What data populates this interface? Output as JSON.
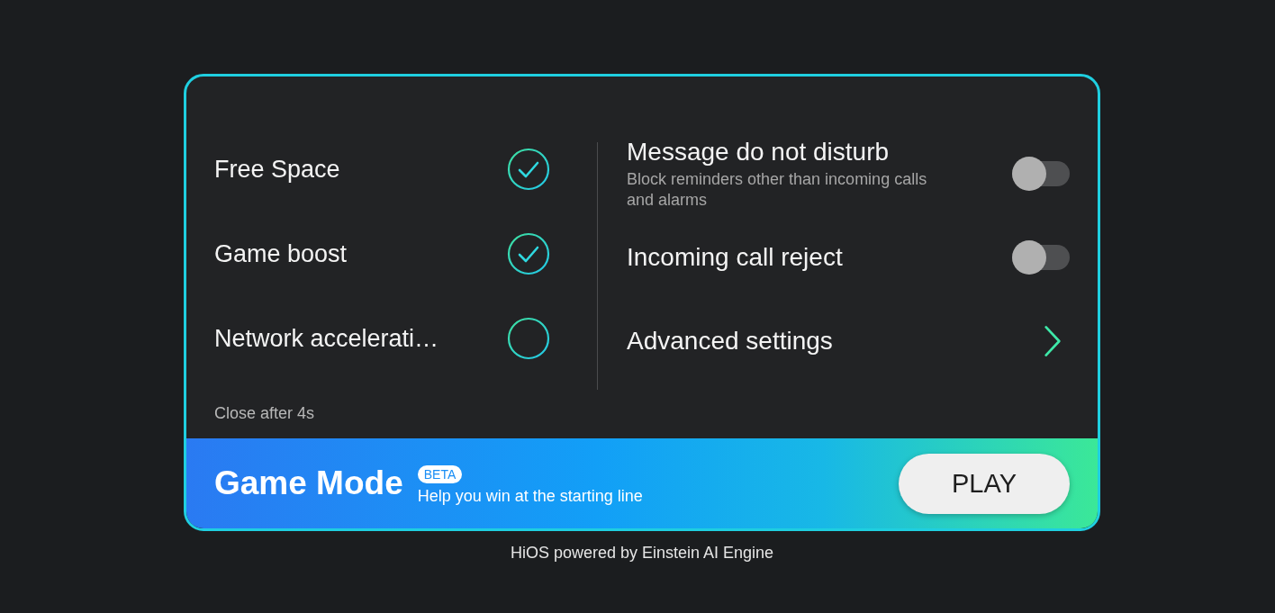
{
  "left_options": [
    {
      "label": "Free Space",
      "checked": true
    },
    {
      "label": "Game boost",
      "checked": true
    },
    {
      "label": "Network accelerati…",
      "checked": false
    }
  ],
  "close_notice": "Close after 4s",
  "right_options": [
    {
      "kind": "toggle",
      "title": "Message do not disturb",
      "subtitle": "Block reminders other than incoming calls and alarms",
      "on": false
    },
    {
      "kind": "toggle",
      "title": "Incoming call reject",
      "on": false
    },
    {
      "kind": "link",
      "title": "Advanced settings"
    }
  ],
  "banner": {
    "title": "Game Mode",
    "badge": "BETA",
    "subtitle": "Help you win at the starting line",
    "button": "PLAY"
  },
  "footer": "HiOS powered by Einstein AI Engine"
}
